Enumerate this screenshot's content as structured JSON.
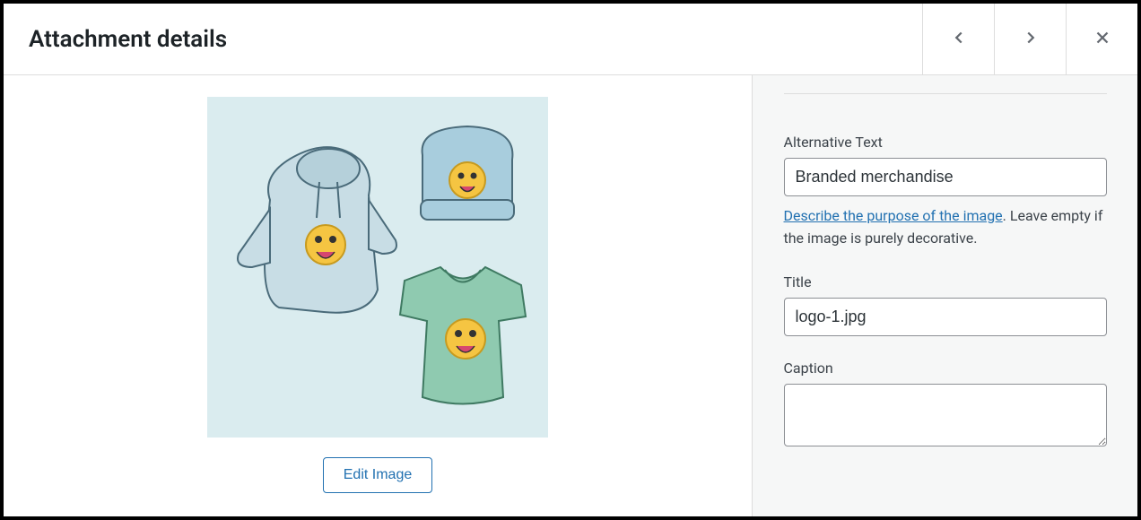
{
  "header": {
    "title": "Attachment details"
  },
  "preview": {
    "edit_button_label": "Edit Image"
  },
  "sidebar": {
    "alt_text": {
      "label": "Alternative Text",
      "value": "Branded merchandise",
      "help_link_text": "Describe the purpose of the image",
      "help_suffix": ". Leave empty if the image is purely decorative."
    },
    "title": {
      "label": "Title",
      "value": "logo-1.jpg"
    },
    "caption": {
      "label": "Caption",
      "value": ""
    }
  }
}
